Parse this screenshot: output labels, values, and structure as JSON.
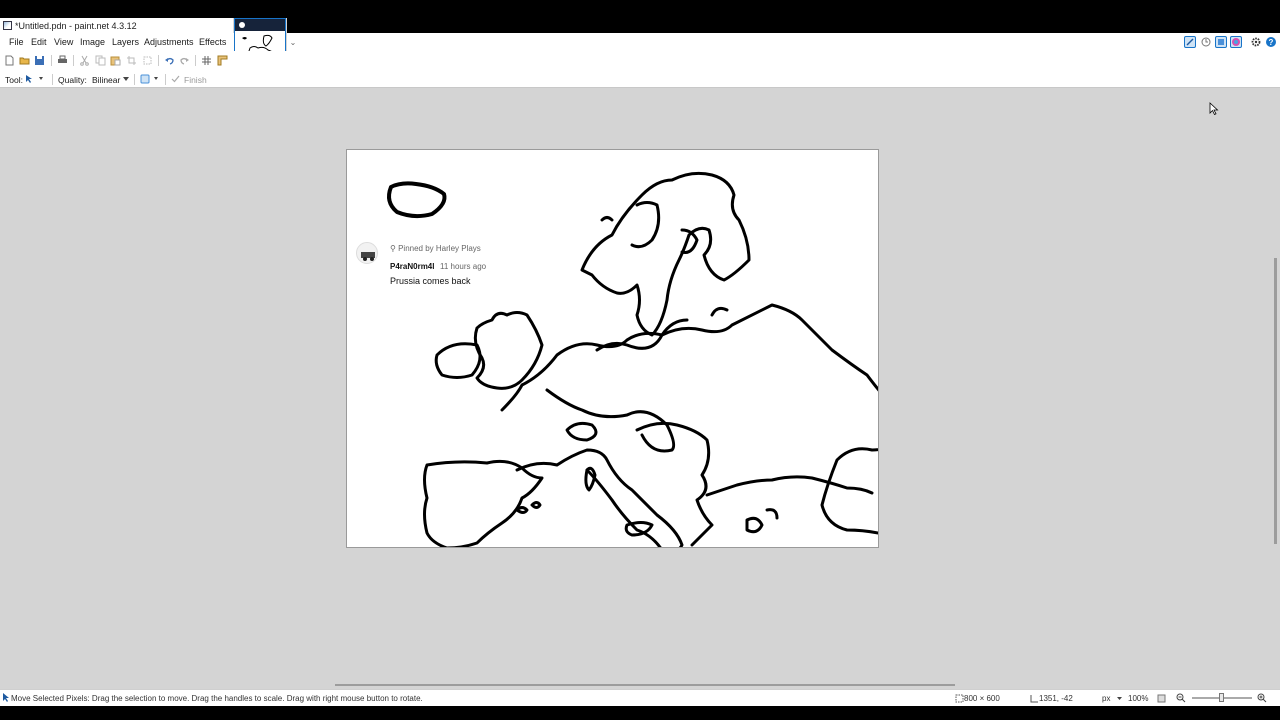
{
  "window": {
    "title": "*Untitled.pdn - paint.net 4.3.12"
  },
  "menu": {
    "items": [
      "File",
      "Edit",
      "View",
      "Image",
      "Layers",
      "Adjustments",
      "Effects"
    ]
  },
  "toolbar": {
    "tool_label": "Tool:",
    "quality_label": "Quality:",
    "quality_value": "Bilinear",
    "finish_label": "Finish"
  },
  "icons": {
    "app": "paintnet-icon",
    "new": "new-file-icon",
    "open": "open-folder-icon",
    "save": "save-icon",
    "print": "print-icon",
    "cut": "cut-icon",
    "copy": "copy-icon",
    "paste": "paste-icon",
    "crop": "crop-icon",
    "deselect": "deselect-icon",
    "undo": "undo-icon",
    "redo": "redo-icon",
    "grid": "grid-icon",
    "ruler": "ruler-icon",
    "tools_window": "tools-window-icon",
    "history_window": "history-window-icon",
    "layers_window": "layers-window-icon",
    "colors_window": "colors-window-icon",
    "settings": "gear-icon",
    "help": "help-icon"
  },
  "canvas": {
    "comment": {
      "pinned": "Pinned by Harley Plays",
      "author": "P4raN0rm4l",
      "time": "11 hours ago",
      "text": "Prussia comes back"
    }
  },
  "status": {
    "message": "Move Selected Pixels: Drag the selection to move. Drag the handles to scale. Drag with right mouse button to rotate.",
    "image_size": "800 × 600",
    "cursor_position": "1351, -42",
    "units": "px",
    "zoom": "100%"
  },
  "colors": {
    "accent": "#1874c8",
    "workspace": "#d4d4d4"
  }
}
